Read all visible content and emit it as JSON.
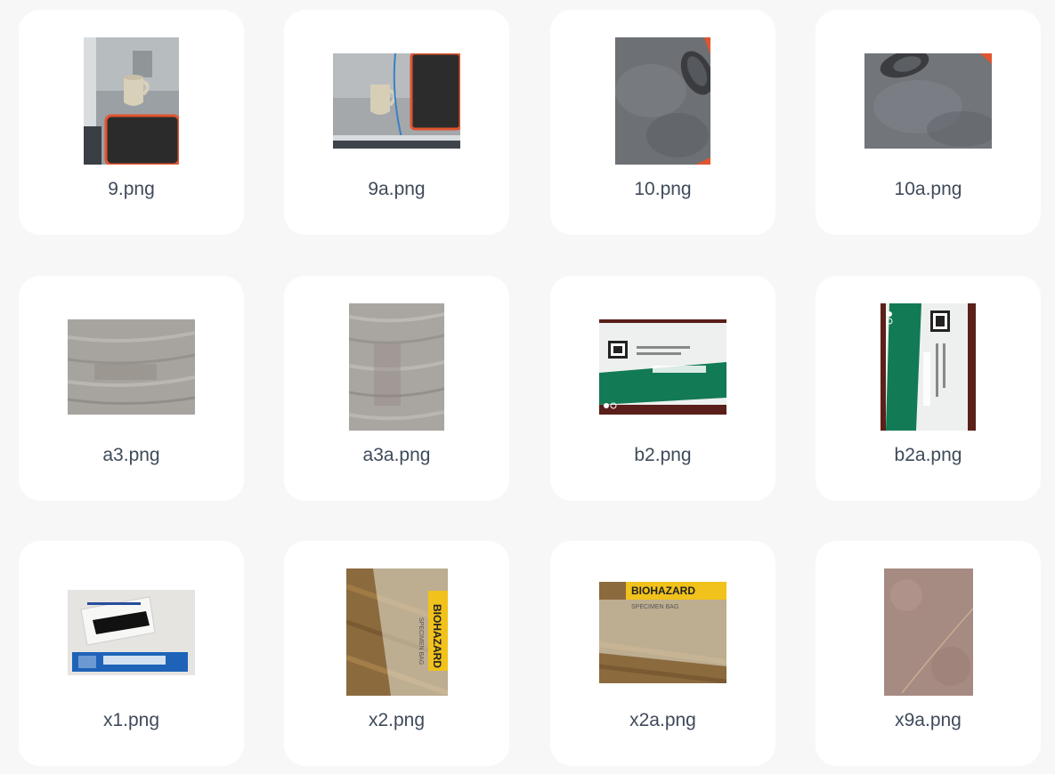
{
  "files": [
    {
      "name": "9.png",
      "thumb": "mug-on-desk-portrait"
    },
    {
      "name": "9a.png",
      "thumb": "mug-on-desk-landscape"
    },
    {
      "name": "10.png",
      "thumb": "mouse-on-mat-portrait"
    },
    {
      "name": "10a.png",
      "thumb": "mouse-on-mat-landscape"
    },
    {
      "name": "a3.png",
      "thumb": "wood-texture-landscape"
    },
    {
      "name": "a3a.png",
      "thumb": "wood-texture-portrait"
    },
    {
      "name": "b2.png",
      "thumb": "test-kit-pouch-landscape"
    },
    {
      "name": "b2a.png",
      "thumb": "test-kit-pouch-portrait"
    },
    {
      "name": "x1.png",
      "thumb": "antigen-test-package"
    },
    {
      "name": "x2.png",
      "thumb": "specimen-bag-portrait"
    },
    {
      "name": "x2a.png",
      "thumb": "specimen-bag-landscape"
    },
    {
      "name": "x9a.png",
      "thumb": "fabric-texture-portrait"
    }
  ],
  "thumb_text": {
    "biohazard": "BIOHAZARD",
    "specimen_bag": "SPECIMEN BAG"
  }
}
